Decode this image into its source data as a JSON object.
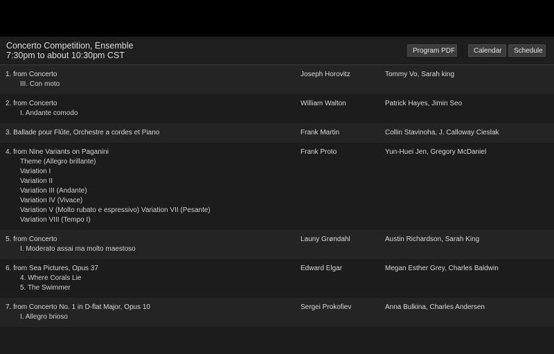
{
  "header": {
    "title": "Concerto Competition, Ensemble",
    "subtitle": "7:30pm to about 10:30pm CST",
    "buttons": {
      "program_pdf": "Program PDF",
      "calendar": "Calendar",
      "schedule": "Schedule"
    }
  },
  "program": [
    {
      "title": "1. from Concerto",
      "movements": [
        "III. Con moto"
      ],
      "composer": "Joseph Horovitz",
      "performers": "Tommy Vo, Sarah king"
    },
    {
      "title": "2. from Concerto",
      "movements": [
        "I. Andante comodo"
      ],
      "composer": "William Walton",
      "performers": "Patrick Hayes, Jimin Seo"
    },
    {
      "title": "3. Ballade pour Flûte, Orchestre a cordes et Piano",
      "movements": [],
      "composer": "Frank Martin",
      "performers": "Collin Stavinoha, J. Calloway Cieslak"
    },
    {
      "title": "4. from Nine Variants on Paganini",
      "movements": [
        "Theme (Allegro brillante)",
        "Variation I",
        "Variation II",
        "Variation III (Andante)",
        "Variation IV (Vivace)",
        "Variation V (Molto rubato e espressivo) Variation VII (Pesante)",
        "Variation VIII (Tempo I)"
      ],
      "composer": "Frank Proto",
      "performers": "Yun-Huei Jen, Gregory McDaniel"
    },
    {
      "title": "5. from Concerto",
      "movements": [
        "I. Moderato assai ma molto maestoso"
      ],
      "composer": "Launy Grøndahl",
      "performers": "Austin Richardson, Sarah King"
    },
    {
      "title": "6. from Sea Pictures, Opus 37",
      "movements": [
        "4. Where Corals Lie",
        "5. The Swimmer"
      ],
      "composer": "Edward Elgar",
      "performers": "Megan Esther Grey, Charles Baldwin"
    },
    {
      "title": "7. from Concerto No. 1 in D-flat Major, Opus 10",
      "movements": [
        "I. Allegro brioso"
      ],
      "composer": "Sergei Prokofiev",
      "performers": "Anna Bulkina, Charles Andersen"
    }
  ]
}
